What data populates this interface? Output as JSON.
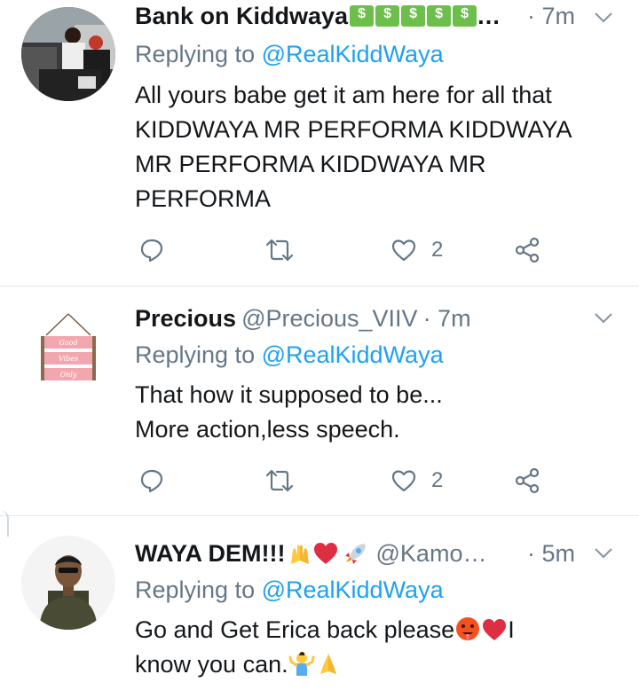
{
  "tweets": [
    {
      "display_name": "Bank on Kiddwaya",
      "name_suffix": "…",
      "handle": "",
      "time": "· 7m",
      "replying_prefix": "Replying to ",
      "replying_to": "@RealKiddWaya",
      "lines": [
        "All yours babe get it am here for all that",
        "KIDDWAYA MR PERFORMA KIDDWAYA",
        "MR PERFORMA KIDDWAYA MR",
        "PERFORMA"
      ],
      "like_count": "2"
    },
    {
      "display_name": "Precious",
      "handle": "@Precious_VIIV",
      "time": "· 7m",
      "replying_prefix": "Replying to ",
      "replying_to": "@RealKiddWaya",
      "lines": [
        "That how it supposed to be...",
        "More action,less speech."
      ],
      "like_count": "2",
      "avatar_sign": [
        "Good",
        "Vibes",
        "Only"
      ]
    },
    {
      "display_name": "WAYA DEM!!!",
      "handle": "@Kamo…",
      "time": "· 5m",
      "replying_prefix": "Replying to ",
      "replying_to": "@RealKiddWaya",
      "line1": "Go and Get Erica back please",
      "line1_end": "I",
      "line2": "know you can."
    }
  ],
  "colors": {
    "text": "#14171a",
    "secondary": "#657786",
    "link": "#1da1f2",
    "divider": "#e1e8ed"
  },
  "icons": [
    "reply-icon",
    "retweet-icon",
    "like-icon",
    "share-icon",
    "chevron-down-icon"
  ]
}
